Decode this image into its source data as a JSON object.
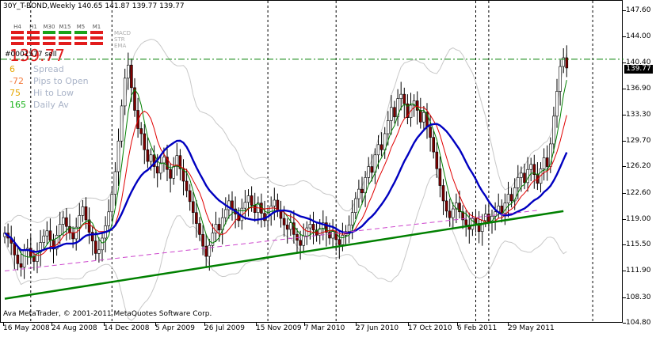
{
  "header": {
    "symbol_line": "30Y_T-BOND,Weekly  140.65 141.87 139.77 139.77"
  },
  "current_price": "139.77",
  "account_label": "#0001577 sell",
  "info_panel": {
    "price": "139.77",
    "rows": [
      {
        "value": "6",
        "label": "Spread",
        "color": "#e6a700"
      },
      {
        "value": "-72",
        "label": "Pips to Open",
        "color": "#f37a3d"
      },
      {
        "value": "75",
        "label": "Hi to Low",
        "color": "#e6a700"
      },
      {
        "value": "165",
        "label": "Daily Av",
        "color": "#19b219"
      }
    ]
  },
  "timeframes": [
    {
      "label": "H4",
      "bars": [
        "#e21c1c",
        "#e21c1c",
        "#e21c1c"
      ]
    },
    {
      "label": "H1",
      "bars": [
        "#e21c1c",
        "#e21c1c",
        "#e21c1c"
      ]
    },
    {
      "label": "M30",
      "bars": [
        "#19a319",
        "#e21c1c",
        "#e21c1c"
      ]
    },
    {
      "label": "M15",
      "bars": [
        "#19a319",
        "#e21c1c",
        "#e21c1c"
      ]
    },
    {
      "label": "M5",
      "bars": [
        "#19a319",
        "#e21c1c",
        "#e21c1c"
      ]
    },
    {
      "label": "M1",
      "bars": [
        "#e21c1c",
        "#e21c1c",
        "#e21c1c"
      ]
    }
  ],
  "indicator_labels": [
    "MACD",
    "STR",
    "EMA"
  ],
  "price_scale": [
    "147.60",
    "144.00",
    "140.40",
    "136.90",
    "133.30",
    "129.70",
    "126.20",
    "122.60",
    "119.00",
    "115.50",
    "111.90",
    "108.30",
    "104.80"
  ],
  "time_labels": [
    "16 May 2008",
    "24 Aug 2008",
    "14 Dec 2008",
    "5 Apr 2009",
    "26 Jul 2009",
    "15 Nov 2009",
    "7 Mar 2010",
    "27 Jun 2010",
    "17 Oct 2010",
    "6 Feb 2011",
    "29 May 2011"
  ],
  "footer": "Ava MetaTrader, © 2001-2011 MetaQuotes Software Corp.",
  "colors": {
    "bull_candle": "#ffffff",
    "bear_candle": "#800000",
    "wick": "#000000",
    "ma_fast": "#008000",
    "ma_mid": "#e00000",
    "ma_slow": "#0000c0",
    "envelope": "#c8c8c8",
    "trendline": "#008000",
    "support_dashed": "#cc44cc",
    "resistance": "#008000"
  },
  "chart_data": {
    "type": "candlestick",
    "symbol": "30Y_T-BOND",
    "timeframe": "Weekly",
    "ohlc_last": {
      "open": 140.65,
      "high": 141.87,
      "low": 139.77,
      "close": 139.77
    },
    "y_range": [
      104.8,
      149.0
    ],
    "x_start": "16 May 2008",
    "closes": [
      117.2,
      116.5,
      115.8,
      114.2,
      113.0,
      112.5,
      114.8,
      115.1,
      114.0,
      113.3,
      114.6,
      115.9,
      116.8,
      117.5,
      116.2,
      115.0,
      116.9,
      118.4,
      119.3,
      118.1,
      117.2,
      116.4,
      118.0,
      119.6,
      120.8,
      119.0,
      117.3,
      116.1,
      114.4,
      114.9,
      116.5,
      118.2,
      120.1,
      122.5,
      125.6,
      129.8,
      134.6,
      138.4,
      140.2,
      137.1,
      134.0,
      131.5,
      130.8,
      128.6,
      127.0,
      127.9,
      126.3,
      125.4,
      126.8,
      127.6,
      125.9,
      124.7,
      126.3,
      127.8,
      126.0,
      124.3,
      123.0,
      121.5,
      120.0,
      118.5,
      117.0,
      115.4,
      114.0,
      115.5,
      117.2,
      118.4,
      117.6,
      119.3,
      120.4,
      121.6,
      120.5,
      119.8,
      118.9,
      120.6,
      121.4,
      122.3,
      121.0,
      120.0,
      121.3,
      119.9,
      118.9,
      119.8,
      120.9,
      121.7,
      120.3,
      119.2,
      118.3,
      117.7,
      118.6,
      117.0,
      116.2,
      115.5,
      116.8,
      117.9,
      118.4,
      117.6,
      116.9,
      117.8,
      118.6,
      117.3,
      116.5,
      117.4,
      116.3,
      115.6,
      116.9,
      117.4,
      118.3,
      120.0,
      121.9,
      123.2,
      122.7,
      124.8,
      126.3,
      125.5,
      127.9,
      129.3,
      128.6,
      130.8,
      132.6,
      134.4,
      133.1,
      135.6,
      136.2,
      134.9,
      133.0,
      134.7,
      135.3,
      134.0,
      132.4,
      133.7,
      131.7,
      130.3,
      128.3,
      126.0,
      123.7,
      121.6,
      120.2,
      119.3,
      120.5,
      121.3,
      120.1,
      119.0,
      118.3,
      117.7,
      119.2,
      118.5,
      117.4,
      118.9,
      119.8,
      118.7,
      119.5,
      120.1,
      120.9,
      119.9,
      121.3,
      122.5,
      121.6,
      123.4,
      124.8,
      125.4,
      124.1,
      125.9,
      126.6,
      125.2,
      124.0,
      126.0,
      127.5,
      126.3,
      129.4,
      133.2,
      136.6,
      140.0,
      141.2,
      139.8
    ],
    "moving_averages": [
      {
        "name": "fast",
        "color": "#008000"
      },
      {
        "name": "mid",
        "color": "#e00000"
      },
      {
        "name": "slow",
        "color": "#0000c0"
      }
    ],
    "trendlines": [
      {
        "from": [
          0,
          108.2
        ],
        "to": [
          172,
          120.2
        ],
        "color": "#008000"
      },
      {
        "from": [
          0,
          112.0
        ],
        "to": [
          164,
          120.3
        ],
        "color": "#cc44cc",
        "style": "dashed"
      },
      {
        "level": 141.0,
        "color": "#008000",
        "style": "dash-dot"
      }
    ],
    "vertical_markers": [
      8,
      33,
      81,
      102,
      145,
      149,
      181
    ],
    "grid": false
  }
}
